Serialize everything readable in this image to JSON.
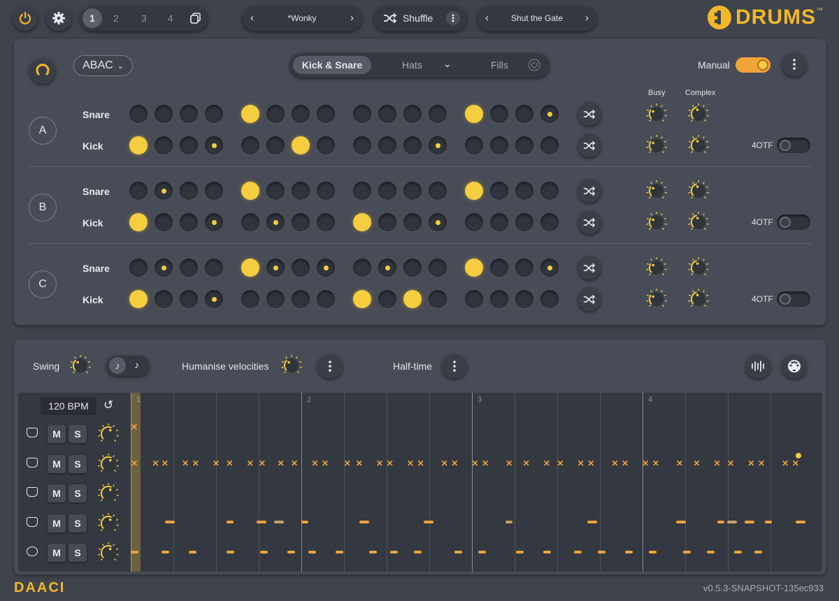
{
  "colors": {
    "accent": "#f6cd3e",
    "orange": "#f2a33a",
    "panel": "#484c56",
    "bg": "#3f434c"
  },
  "topbar": {
    "power_icon": "power-icon",
    "settings_icon": "gear-icon",
    "slots": [
      "1",
      "2",
      "3",
      "4"
    ],
    "active_slot": "1",
    "preset_left": "*Wonky",
    "shuffle_label": "Shuffle",
    "preset_right": "Shut the Gate",
    "logo": "DRUMS",
    "logo_mark": "™"
  },
  "pattern": {
    "structure": "ABAC",
    "tabs": [
      "Kick & Snare",
      "Hats",
      "Fills"
    ],
    "active_tab": "Kick & Snare",
    "manual_label": "Manual",
    "busy_label": "Busy",
    "complex_label": "Complex",
    "sections": [
      {
        "name": "A",
        "rows": [
          {
            "label": "Snare",
            "steps": [
              0,
              0,
              0,
              0,
              2,
              0,
              0,
              0,
              0,
              0,
              0,
              0,
              2,
              0,
              0,
              1
            ]
          },
          {
            "label": "Kick",
            "steps": [
              2,
              0,
              0,
              1,
              0,
              0,
              2,
              0,
              0,
              0,
              0,
              1,
              0,
              0,
              0,
              0
            ]
          }
        ],
        "otf_label": "4OTF"
      },
      {
        "name": "B",
        "rows": [
          {
            "label": "Snare",
            "steps": [
              0,
              1,
              0,
              0,
              2,
              0,
              0,
              0,
              0,
              0,
              0,
              0,
              2,
              0,
              0,
              0
            ]
          },
          {
            "label": "Kick",
            "steps": [
              2,
              0,
              0,
              1,
              0,
              1,
              0,
              0,
              2,
              0,
              0,
              1,
              0,
              0,
              0,
              0
            ]
          }
        ],
        "otf_label": "4OTF"
      },
      {
        "name": "C",
        "rows": [
          {
            "label": "Snare",
            "steps": [
              0,
              1,
              0,
              0,
              2,
              1,
              0,
              1,
              0,
              1,
              0,
              0,
              2,
              0,
              0,
              1
            ]
          },
          {
            "label": "Kick",
            "steps": [
              2,
              0,
              0,
              1,
              0,
              0,
              0,
              0,
              2,
              0,
              2,
              0,
              0,
              0,
              0,
              0
            ]
          }
        ],
        "otf_label": "4OTF"
      }
    ]
  },
  "lower": {
    "swing_label": "Swing",
    "humanise_label": "Humanise velocities",
    "halftime_label": "Half-time",
    "bpm": "120 BPM",
    "bars": [
      "1",
      "2",
      "3",
      "4"
    ],
    "tracks": [
      {
        "icon": "cymbal-icon",
        "m": "M",
        "s": "S"
      },
      {
        "icon": "hihat-icon",
        "m": "M",
        "s": "S"
      },
      {
        "icon": "tom-icon",
        "m": "M",
        "s": "S"
      },
      {
        "icon": "snare-drum-icon",
        "m": "M",
        "s": "S"
      },
      {
        "icon": "kick-drum-icon",
        "m": "M",
        "s": "S"
      }
    ],
    "notes_x": [
      {
        "track": 0,
        "pos": 0.0
      }
    ],
    "notes_hats": [
      0.0,
      0.0625,
      0.09,
      0.15,
      0.18,
      0.24,
      0.28,
      0.34,
      0.375,
      0.43,
      0.47,
      0.53,
      0.56,
      0.625,
      0.66,
      0.72,
      0.75,
      0.81,
      0.84,
      0.91,
      0.94,
      1.0,
      1.03,
      1.1,
      1.15,
      1.21,
      1.25,
      1.31,
      1.34,
      1.41,
      1.44,
      1.5,
      1.53,
      1.6,
      1.65,
      1.71,
      1.75,
      1.81,
      1.84,
      1.91,
      1.94
    ],
    "snare_dashes": [
      0.1,
      0.28,
      0.37,
      0.42,
      0.5,
      0.67,
      0.86,
      1.1,
      1.34,
      1.6,
      1.72,
      1.75,
      1.8,
      1.86,
      1.95
    ],
    "kick_dashes": [
      0.0,
      0.09,
      0.17,
      0.28,
      0.38,
      0.46,
      0.52,
      0.6,
      0.7,
      0.76,
      0.83,
      0.95,
      1.02,
      1.13,
      1.21,
      1.3,
      1.37,
      1.45,
      1.52,
      1.62,
      1.69,
      1.77,
      1.83
    ]
  },
  "footer": {
    "brand": "DAACI",
    "version": "v0.5.3-SNAPSHOT-135ec933"
  }
}
